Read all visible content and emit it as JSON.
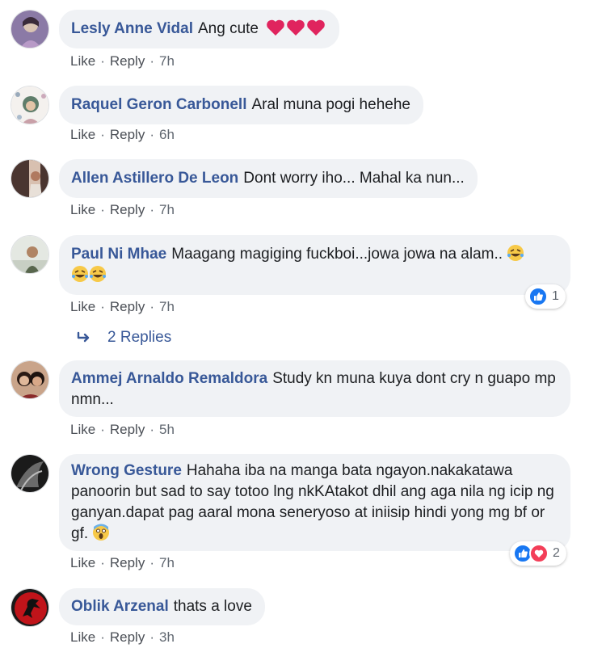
{
  "actions": {
    "like": "Like",
    "reply": "Reply",
    "separator": "·"
  },
  "comments": [
    {
      "author": "Lesly Anne Vidal",
      "text": "Ang cute",
      "time": "7h"
    },
    {
      "author": "Raquel Geron Carbonell",
      "text": "Aral muna pogi hehehe",
      "time": "6h"
    },
    {
      "author": "Allen Astillero De Leon",
      "text": "Dont worry iho... Mahal ka nun...",
      "time": "7h"
    },
    {
      "author": "Paul Ni Mhae",
      "text": "Maagang magiging fuckboi...jowa jowa na alam..",
      "time": "7h",
      "reaction_count": "1"
    },
    {
      "author": "Ammej Arnaldo Remaldora",
      "text": "Study kn muna kuya dont cry n guapo mp nmn...",
      "time": "5h"
    },
    {
      "author": "Wrong Gesture",
      "text": "Hahaha iba na manga bata ngayon.nakakatawa panoorin but sad to say totoo lng nkKAtakot dhil ang aga nila ng icip ng ganyan.dapat pag aaral mona seneryoso at iniisip hindi yong mg bf or gf.",
      "time": "7h",
      "reaction_count": "2"
    },
    {
      "author": "Oblik Arzenal",
      "text": "thats a love",
      "time": "3h"
    }
  ],
  "replies": {
    "label": "2 Replies"
  },
  "colors": {
    "author": "#385898",
    "bubble": "#f0f2f5",
    "action_text": "#606770",
    "like_blue": "#1877f2",
    "love_red": "#f33e58"
  },
  "icons": {
    "heart": "heart-emoji",
    "laugh": "rolling-laughing-emoji",
    "scream": "screaming-emoji",
    "like_reaction": "like-reaction-icon",
    "love_reaction": "love-reaction-icon",
    "reply_arrow": "reply-arrow-icon"
  }
}
